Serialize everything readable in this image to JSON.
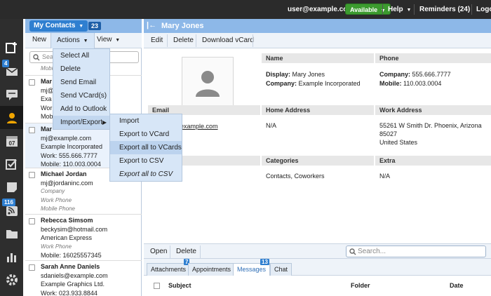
{
  "topbar": {
    "user": "user@example.com",
    "status": "Available",
    "help": "Help",
    "reminders": "Reminders (24)",
    "logout": "Logout"
  },
  "rail": {
    "items": [
      {
        "name": "compose-icon",
        "badge": ""
      },
      {
        "name": "mail-icon",
        "badge": "4"
      },
      {
        "name": "chat-icon",
        "badge": ""
      },
      {
        "name": "contacts-icon",
        "badge": ""
      },
      {
        "name": "calendar-icon",
        "badge": "07"
      },
      {
        "name": "tasks-icon",
        "badge": ""
      },
      {
        "name": "notes-icon",
        "badge": ""
      },
      {
        "name": "feeds-icon",
        "badge": "116"
      },
      {
        "name": "files-icon",
        "badge": ""
      },
      {
        "name": "reports-icon",
        "badge": ""
      },
      {
        "name": "settings-icon",
        "badge": ""
      }
    ]
  },
  "list": {
    "folder": "My Contacts",
    "count": "23",
    "toolbar": {
      "new": "New",
      "actions": "Actions",
      "view": "View"
    },
    "search_placeholder": "Sea",
    "contacts": [
      {
        "lines": [
          "Mobile"
        ],
        "first_dim": true
      },
      {
        "lines": [
          "Mar",
          "mj@",
          "Exa",
          "Wor",
          "Mob"
        ]
      },
      {
        "lines": [
          "Mar",
          "mj@example.com",
          "Example Incorporated",
          "Work: 555.666.7777",
          "Mobile: 110.003.0004"
        ]
      },
      {
        "lines": [
          "Michael Jordan",
          "mj@jordaninc.com",
          "Company",
          "Work Phone",
          "Mobile Phone"
        ]
      },
      {
        "lines": [
          "Rebecca Simsom",
          "beckysim@hotmail.com",
          "American Express",
          "Work Phone",
          "Mobile: 16025557345"
        ]
      },
      {
        "lines": [
          "Sarah Anne Daniels",
          "sdaniels@example.com",
          "Example Graphics Ltd.",
          "Work: 023.933.8844"
        ]
      }
    ]
  },
  "actions_menu": {
    "items": [
      "Select All",
      "Delete",
      "Send Email",
      "Send VCard(s)",
      "Add to Outlook",
      "Import/Export"
    ]
  },
  "import_export_menu": {
    "items": [
      "Import",
      "Export to VCard",
      "Export all to VCards",
      "Export to CSV",
      "Export all to CSV"
    ]
  },
  "detail": {
    "name": "Mary Jones",
    "toolbar": {
      "edit": "Edit",
      "delete": "Delete",
      "download": "Download vCard"
    },
    "fields": {
      "name_label": "Name",
      "display_label": "Display:",
      "display_value": "Mary Jones",
      "company_label": "Company:",
      "company_value": "Example Incorporated",
      "phone_label": "Phone",
      "phone_company_label": "Company:",
      "phone_company_value": "555.666.7777",
      "phone_mobile_label": "Mobile:",
      "phone_mobile_value": "110.003.0004",
      "email_label": "Email",
      "email_value": "example.com",
      "home_address_label": "Home Address",
      "home_address_value": "N/A",
      "work_address_label": "Work Address",
      "work_address_lines": [
        "55261 W Smith Dr. Phoenix, Arizona",
        "85027",
        "United States"
      ],
      "categories_label": "Categories",
      "categories_value": "Contacts, Coworkers",
      "extra_label": "Extra",
      "extra_value": "N/A"
    }
  },
  "bottom": {
    "open": "Open",
    "delete": "Delete",
    "search_placeholder": "Search...",
    "tabs": [
      {
        "label": "Attachments",
        "badge": "7"
      },
      {
        "label": "Appointments",
        "badge": ""
      },
      {
        "label": "Messages",
        "badge": "13"
      },
      {
        "label": "Chat",
        "badge": ""
      }
    ],
    "columns": {
      "subject": "Subject",
      "folder": "Folder",
      "date": "Date"
    }
  }
}
